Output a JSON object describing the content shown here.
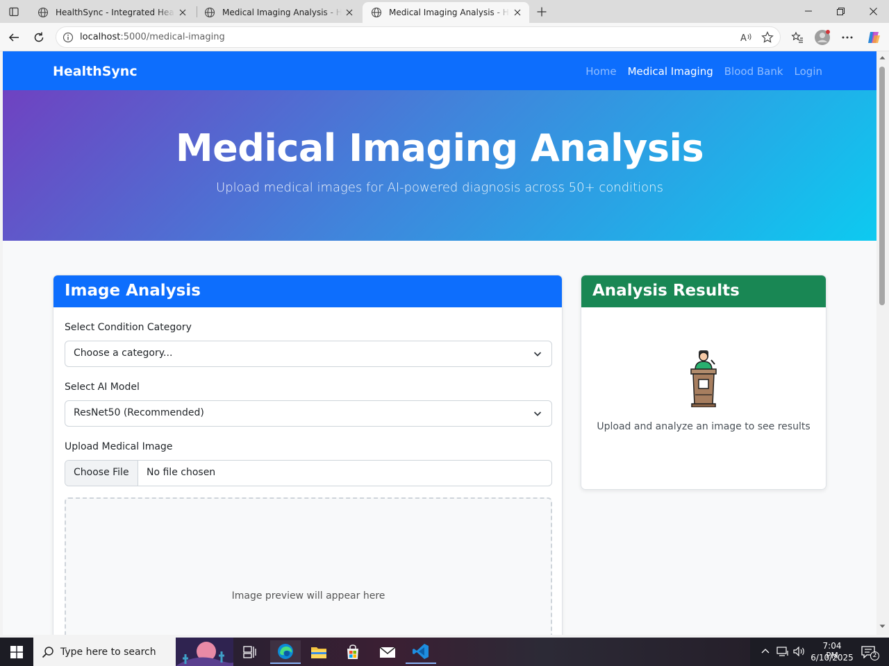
{
  "browser": {
    "tabs": [
      {
        "title": "HealthSync - Integrated Healthcare"
      },
      {
        "title": "Medical Imaging Analysis - HealthSync"
      },
      {
        "title": "Medical Imaging Analysis - HealthSync"
      }
    ],
    "url_host": "localhost",
    "url_path": ":5000/medical-imaging"
  },
  "navbar": {
    "brand": "HealthSync",
    "links": [
      {
        "label": "Home",
        "active": false
      },
      {
        "label": "Medical Imaging",
        "active": true
      },
      {
        "label": "Blood Bank",
        "active": false
      },
      {
        "label": "Login",
        "active": false
      }
    ]
  },
  "hero": {
    "title": "Medical Imaging Analysis",
    "subtitle": "Upload medical images for AI-powered diagnosis across 50+ conditions"
  },
  "analysis_card": {
    "title": "Image Analysis",
    "category_label": "Select Condition Category",
    "category_value": "Choose a category...",
    "model_label": "Select AI Model",
    "model_value": "ResNet50 (Recommended)",
    "upload_label": "Upload Medical Image",
    "choose_file": "Choose File",
    "no_file": "No file chosen",
    "preview_text": "Image preview will appear here"
  },
  "results_card": {
    "title": "Analysis Results",
    "icon": "podium-speaker-icon",
    "placeholder": "Upload and analyze an image to see results"
  },
  "taskbar": {
    "search_placeholder": "Type here to search",
    "time": "7:04 PM",
    "date": "6/10/2025",
    "notification_count": "2"
  },
  "colors": {
    "primary": "#0d6efd",
    "success": "#198754",
    "hero_start": "#6f42c1",
    "hero_end": "#0dcaf0"
  }
}
